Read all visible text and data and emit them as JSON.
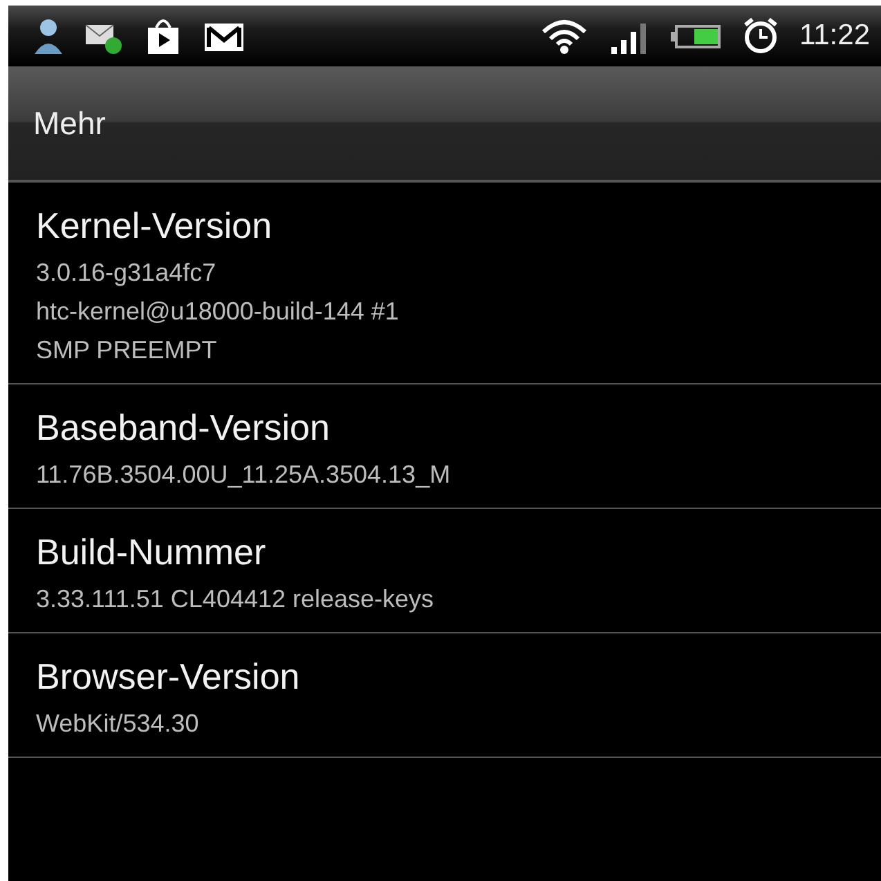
{
  "status_bar": {
    "time": "11:22"
  },
  "header": {
    "title": "Mehr"
  },
  "items": [
    {
      "title": "Kernel-Version",
      "lines": [
        "3.0.16-g31a4fc7",
        "htc-kernel@u18000-build-144 #1",
        "SMP PREEMPT"
      ]
    },
    {
      "title": "Baseband-Version",
      "lines": [
        "11.76B.3504.00U_11.25A.3504.13_M"
      ]
    },
    {
      "title": "Build-Nummer",
      "lines": [
        "3.33.111.51 CL404412 release-keys"
      ]
    },
    {
      "title": "Browser-Version",
      "lines": [
        "WebKit/534.30"
      ]
    }
  ]
}
